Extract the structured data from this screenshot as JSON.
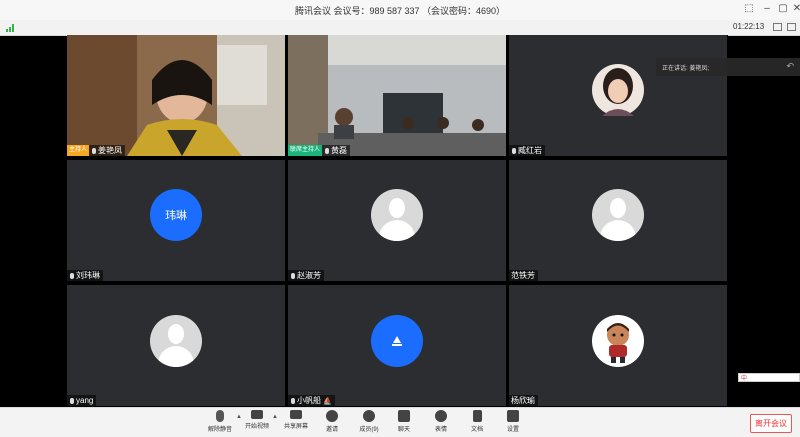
{
  "window": {
    "title": "腾讯会议 会议号：989 587 337 （会议密码：4690）",
    "elapsed": "01:22:13"
  },
  "speaking": {
    "label": "正在讲话: 姜艳凤;"
  },
  "participants": [
    {
      "name": "姜艳凤",
      "badge": "主持人",
      "kind": "video"
    },
    {
      "name": "黄磊",
      "badge": "联席主持人",
      "kind": "video"
    },
    {
      "name": "臧红岩",
      "kind": "photo"
    },
    {
      "name": "刘玮琳",
      "avatar_text": "玮琳",
      "kind": "letter"
    },
    {
      "name": "赵淑芳",
      "kind": "default"
    },
    {
      "name": "范铁芳",
      "kind": "default"
    },
    {
      "name": "yang",
      "kind": "default"
    },
    {
      "name": "小帆船",
      "kind": "letter-icon"
    },
    {
      "name": "杨欣瑜",
      "kind": "doll"
    }
  ],
  "toolbar": {
    "unmute": "解除静音",
    "start_video": "开始视频",
    "share_screen": "共享屏幕",
    "invite": "邀请",
    "members": "成员(9)",
    "chat": "聊天",
    "reactions": "表情",
    "docs": "文档",
    "settings": "设置",
    "leave": "离开会议"
  },
  "ime": {
    "label": "中"
  },
  "colors": {
    "host_badge": "#f5a623",
    "cohost_badge": "#1bb57c",
    "avatar_blue": "#1a6dff",
    "leave_red": "#e33333"
  }
}
